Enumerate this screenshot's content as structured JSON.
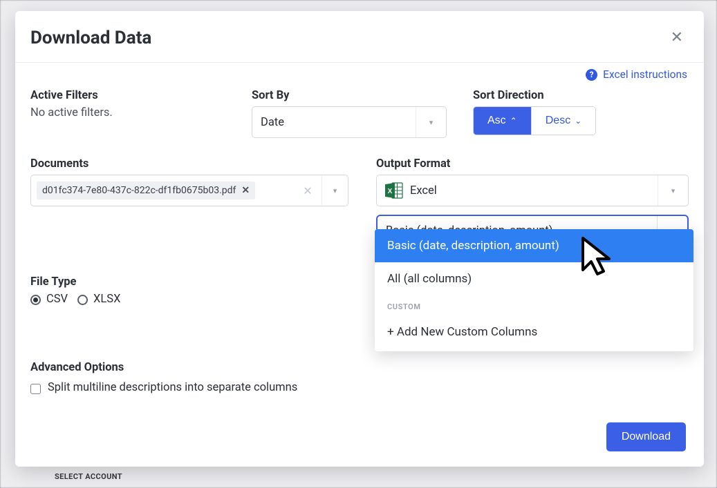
{
  "background": {
    "select_account": "SELECT ACCOUNT"
  },
  "modal": {
    "title": "Download Data",
    "help_link": "Excel instructions",
    "active_filters": {
      "label": "Active Filters",
      "value": "No active filters."
    },
    "sort_by": {
      "label": "Sort By",
      "value": "Date"
    },
    "sort_direction": {
      "label": "Sort Direction",
      "asc": "Asc",
      "desc": "Desc"
    },
    "documents": {
      "label": "Documents",
      "tag": "d01fc374-7e80-437c-822c-df1fb0675b03.pdf"
    },
    "output_format": {
      "label": "Output Format",
      "value": "Excel"
    },
    "columns_select": {
      "value": "Basic (date, description, amount)"
    },
    "dropdown": {
      "opt_basic": "Basic (date, description, amount)",
      "opt_all": "All (all columns)",
      "group_custom": "CUSTOM",
      "opt_add": "+ Add New Custom Columns"
    },
    "file_type": {
      "label": "File Type",
      "csv": "CSV",
      "xlsx": "XLSX"
    },
    "advanced": {
      "label": "Advanced Options",
      "split": "Split multiline descriptions into separate columns"
    },
    "download": "Download"
  }
}
